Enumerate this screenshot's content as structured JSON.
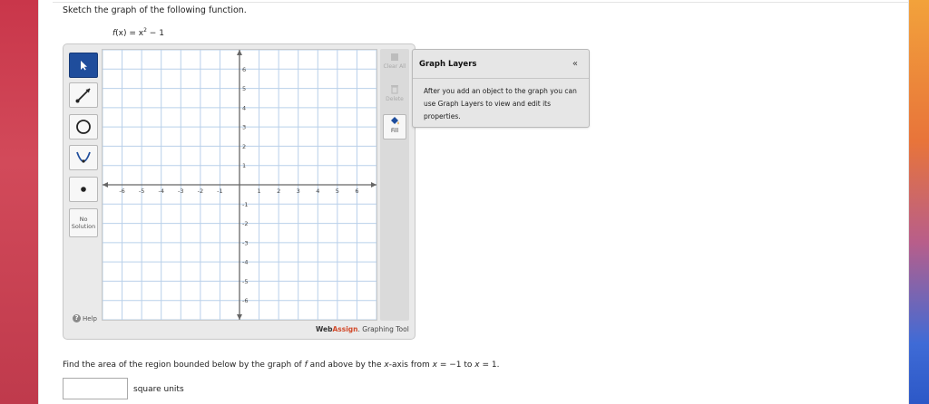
{
  "question": {
    "instruction": "Sketch the graph of the following function.",
    "function_name": "f",
    "function_rest": "(x) = x",
    "function_exponent": "2",
    "function_tail": " − 1"
  },
  "toolbar": {
    "tools": [
      {
        "name": "pointer",
        "active": true
      },
      {
        "name": "line-segment",
        "active": false
      },
      {
        "name": "circle",
        "active": false
      },
      {
        "name": "parabola",
        "active": false
      },
      {
        "name": "point",
        "active": false
      }
    ],
    "no_solution_line1": "No",
    "no_solution_line2": "Solution",
    "help_label": "Help"
  },
  "right_tools": {
    "clear_all_label": "Clear All",
    "delete_label": "Delete",
    "fill_label": "Fill"
  },
  "graph": {
    "x_range": [
      -7,
      7
    ],
    "y_range": [
      -7,
      7
    ],
    "x_ticks": [
      "-6",
      "-5",
      "-4",
      "-3",
      "-2",
      "-1",
      "1",
      "2",
      "3",
      "4",
      "5",
      "6"
    ],
    "y_ticks": [
      "6",
      "5",
      "4",
      "3",
      "2",
      "1",
      "-1",
      "-2",
      "-3",
      "-4",
      "-5",
      "-6"
    ],
    "grid_color": "#b9d0ea",
    "axis_color": "#666666"
  },
  "branding": {
    "web": "Web",
    "assign": "Assign",
    "suffix": ". Graphing Tool"
  },
  "layers_panel": {
    "title": "Graph Layers",
    "collapse_glyph": "«",
    "body": "After you add an object to the graph you can use Graph Layers to view and edit its properties."
  },
  "area_question": {
    "part1": "Find the area of the region bounded below by the graph of ",
    "f": "f",
    "part2": " and above by the ",
    "x": "x",
    "part3": "-axis from ",
    "x2": "x",
    "part4": " = −1 to ",
    "x3": "x",
    "part5": " = 1.",
    "answer_value": "",
    "units": "square units"
  }
}
